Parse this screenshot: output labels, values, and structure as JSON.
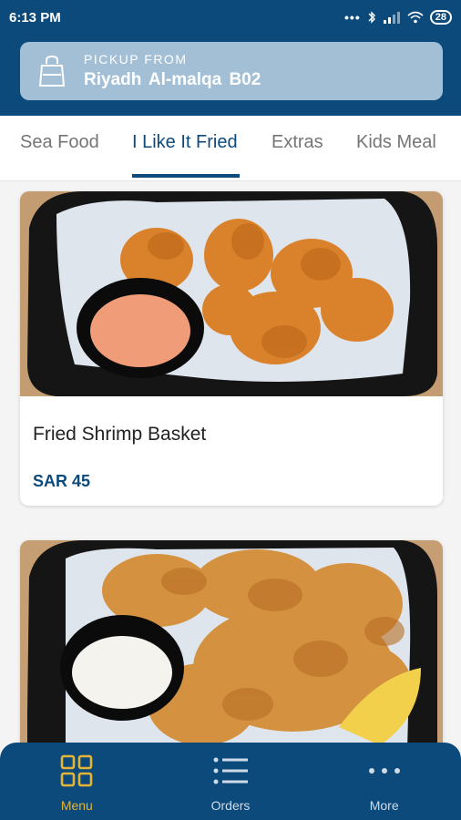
{
  "status_bar": {
    "time": "6:13 PM",
    "battery": "28",
    "dots": "•••"
  },
  "pickup": {
    "label": "PICKUP FROM",
    "location": "Riyadh  Al-malqa B02",
    "icon": "bag-icon"
  },
  "tabs": [
    {
      "label": "Sea Food",
      "active": false
    },
    {
      "label": "I Like It Fried",
      "active": true
    },
    {
      "label": "Extras",
      "active": false
    },
    {
      "label": "Kids Meal",
      "active": false
    }
  ],
  "items": [
    {
      "title": "Fried Shrimp Basket",
      "price": "SAR 45",
      "image": "fried-shrimp-photo"
    },
    {
      "title": "",
      "price": "",
      "image": "fried-calamari-photo"
    }
  ],
  "nav": [
    {
      "label": "Menu",
      "icon": "grid-icon",
      "active": true
    },
    {
      "label": "Orders",
      "icon": "list-icon",
      "active": false
    },
    {
      "label": "More",
      "icon": "more-dots-icon",
      "active": false
    }
  ],
  "colors": {
    "primary": "#0d4a7c",
    "accent": "#e3b436",
    "pickup_bg": "#a2bfd5"
  }
}
